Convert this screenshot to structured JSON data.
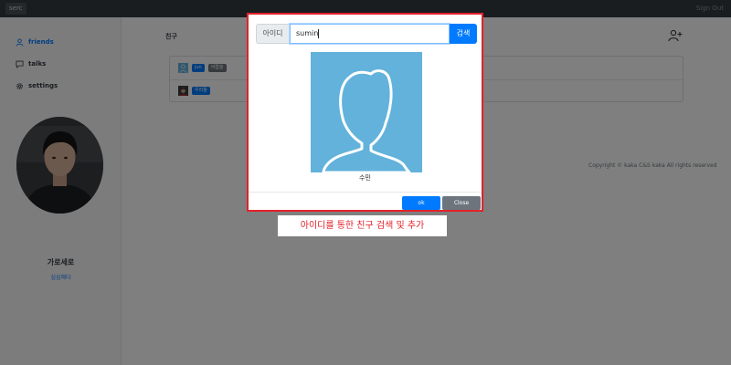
{
  "navbar": {
    "brand": "serc",
    "signout": "Sign Out"
  },
  "sidebar": {
    "items": [
      {
        "label": "friends",
        "icon": "person-icon",
        "active": true
      },
      {
        "label": "talks",
        "icon": "chat-icon",
        "active": false
      },
      {
        "label": "settings",
        "icon": "gear-icon",
        "active": false
      }
    ],
    "profile": {
      "name": "가로세로",
      "status": "심심해다"
    }
  },
  "main": {
    "section_title": "친구",
    "friends": [
      {
        "name_badge": "jun",
        "tag_badge": "어랍을"
      },
      {
        "name_badge": "우리들"
      }
    ],
    "copyright": "Copyright © kaka C&S kaka All rights reserved"
  },
  "modal": {
    "id_label": "아이디",
    "search_value": "sumin",
    "search_button": "검색",
    "result_name": "수민",
    "ok_label": "ok",
    "close_label": "Close"
  },
  "caption": "아이디를 통한 친구 검색 및 추가",
  "colors": {
    "accent": "#007bff",
    "secondary": "#6c757d",
    "highlight": "#e3212b",
    "avatar_bg": "#62b2db"
  }
}
